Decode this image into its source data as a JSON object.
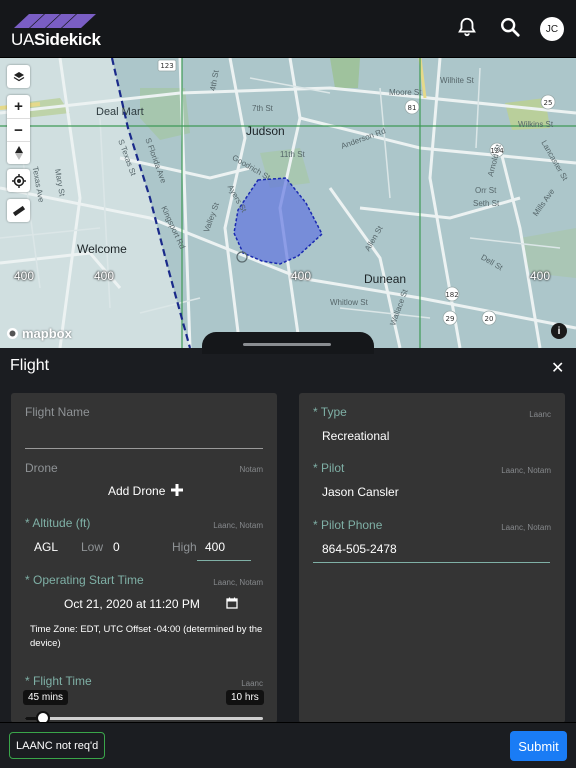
{
  "header": {
    "logo_prefix": "UA",
    "logo_bold": "Sidekick",
    "user_initials": "JC",
    "icons": [
      "bell-icon",
      "search-icon"
    ]
  },
  "map": {
    "towns": [
      "Judson",
      "Welcome",
      "Dunean"
    ],
    "poi": [
      "Deal Mart"
    ],
    "altitudes": [
      "400",
      "400",
      "400",
      "400"
    ],
    "streets": [
      "4th St",
      "7th St",
      "11th St",
      "Goodrich St",
      "Ayers St",
      "Valley St",
      "S Texas St",
      "S Florida Ave",
      "Kingsport Rd",
      "Mary St",
      "Texas Ave",
      "Anderson Rd",
      "Allen St",
      "Whitlow St",
      "Wallace St",
      "Moore St",
      "Wilkins St",
      "Arnold St",
      "Orr St",
      "Seth St",
      "Mills Ave",
      "Lancaster St",
      "Wilhite St",
      "Dell St"
    ],
    "road_shields": [
      "123",
      "81",
      "29",
      "20",
      "25",
      "124",
      "182"
    ],
    "attribution": "mapbox",
    "controls": [
      "layers-icon",
      "zoom-in-icon",
      "zoom-out-icon",
      "compass-icon",
      "locate-icon",
      "measure-icon"
    ]
  },
  "sheet": {
    "title": "Flight",
    "close_label": "✕"
  },
  "form_left": {
    "flight_name_label": "Flight Name",
    "drone_label": "Drone",
    "drone_tag": "Notam",
    "add_drone_label": "Add Drone",
    "altitude_label": "Altitude (ft)",
    "altitude_tag": "Laanc, Notam",
    "altitude_ref": "AGL",
    "low_label": "Low",
    "low_value": "0",
    "high_label": "High",
    "high_value": "400",
    "start_time_label": "Operating Start Time",
    "start_time_tag": "Laanc, Notam",
    "start_time_value": "Oct 21, 2020 at 11:20 PM",
    "timezone_note": "Time Zone: EDT, UTC Offset -04:00 (determined by the device)",
    "flight_time_label": "Flight Time",
    "flight_time_tag": "Laanc",
    "flight_time_value": "45 mins",
    "flight_time_max": "10 hrs",
    "flight_time_fraction": 0.075
  },
  "form_right": {
    "type_label": "Type",
    "type_tag": "Laanc",
    "type_value": "Recreational",
    "pilot_label": "Pilot",
    "pilot_tag": "Laanc, Notam",
    "pilot_value": "Jason Cansler",
    "phone_label": "Pilot Phone",
    "phone_tag": "Laanc, Notam",
    "phone_value": "864-505-2478"
  },
  "footer": {
    "laanc_status": "LAANC not req'd",
    "submit_label": "Submit",
    "colors": {
      "submit": "#1a7cf5",
      "status_border": "#3aa64a"
    }
  }
}
